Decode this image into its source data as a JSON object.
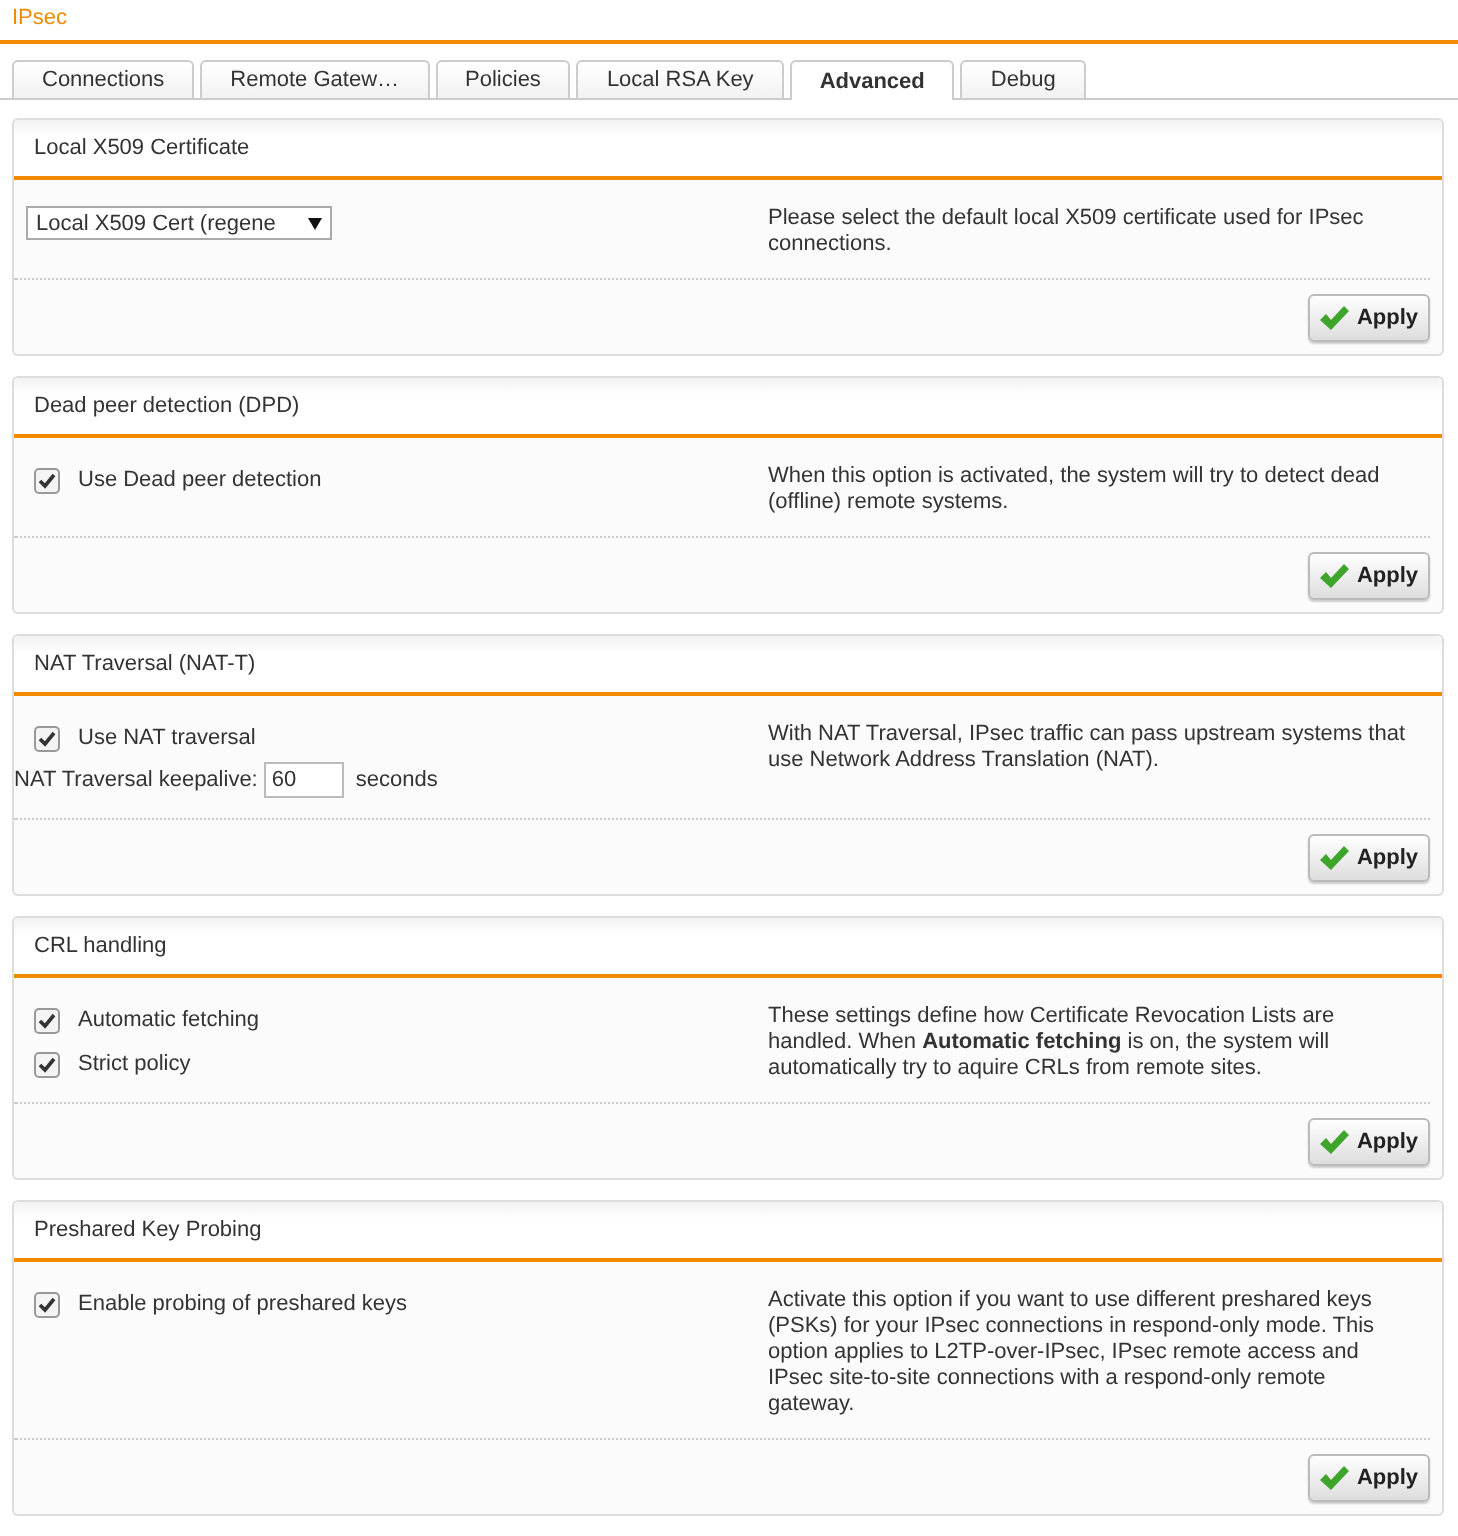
{
  "page_title": "IPsec",
  "tabs": [
    {
      "label": "Connections",
      "selected": false
    },
    {
      "label": "Remote Gatew…",
      "selected": false
    },
    {
      "label": "Policies",
      "selected": false
    },
    {
      "label": "Local RSA Key",
      "selected": false
    },
    {
      "label": "Advanced",
      "selected": true
    },
    {
      "label": "Debug",
      "selected": false
    }
  ],
  "sections": [
    {
      "title": "Local X509 Certificate",
      "controls": [
        {
          "kind": "select",
          "value": "Local X509 Cert (regene"
        }
      ],
      "description": "Please select the default local X509 certificate used for IPsec connections.",
      "apply": "Apply"
    },
    {
      "title": "Dead peer detection (DPD)",
      "controls": [
        {
          "kind": "checkbox",
          "label": "Use Dead peer detection",
          "checked": true
        }
      ],
      "description": "When this option is activated, the system will try to detect dead (offline) remote systems.",
      "apply": "Apply"
    },
    {
      "title": "NAT Traversal (NAT-T)",
      "controls": [
        {
          "kind": "checkbox",
          "label": "Use NAT traversal",
          "checked": true
        },
        {
          "kind": "field",
          "label": "NAT Traversal keepalive:",
          "value": "60",
          "unit": "seconds"
        }
      ],
      "description": "With NAT Traversal, IPsec traffic can pass upstream systems that use Network Address Translation (NAT).",
      "apply": "Apply"
    },
    {
      "title": "CRL handling",
      "controls": [
        {
          "kind": "checkbox",
          "label": "Automatic fetching",
          "checked": true
        },
        {
          "kind": "checkbox",
          "label": "Strict policy",
          "checked": true
        }
      ],
      "description": "These settings define how Certificate Revocation Lists are handled. When **Automatic fetching** is on, the system will automatically try to aquire CRLs from remote sites.",
      "apply": "Apply"
    },
    {
      "title": "Preshared Key Probing",
      "controls": [
        {
          "kind": "checkbox",
          "label": "Enable probing of preshared keys",
          "checked": true
        }
      ],
      "description": "Activate this option if you want to use different preshared keys (PSKs) for your IPsec connections in respond-only mode. This option applies to L2TP-over-IPsec, IPsec remote access and IPsec site-to-site connections with a respond-only remote gateway.",
      "apply": "Apply"
    }
  ]
}
